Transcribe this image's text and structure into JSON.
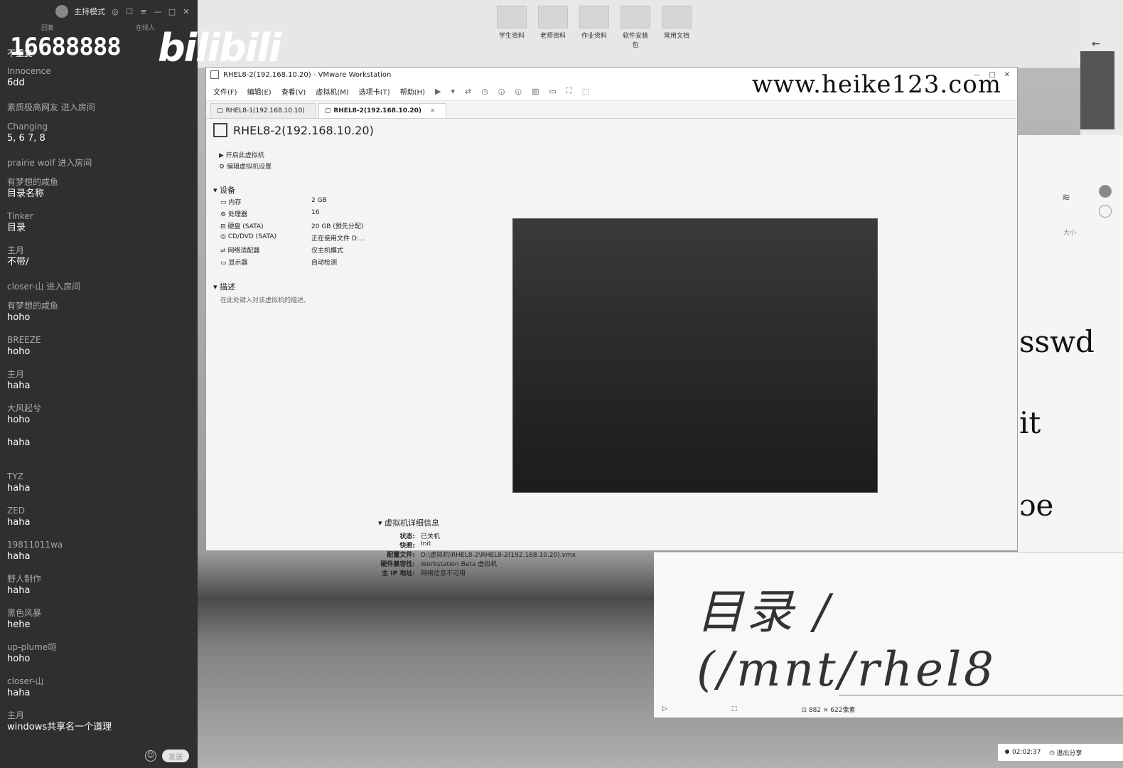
{
  "chat": {
    "host_mode": "主持模式",
    "sub_left": "回复",
    "sub_right": "在线人",
    "big_number": "16688888",
    "brand": "bilibili",
    "banner_label": "不重复",
    "messages": [
      {
        "user": "Innocence",
        "text": "6dd"
      },
      {
        "user": "素质极高网友 进入房间",
        "text": ""
      },
      {
        "user": "Changing",
        "text": "5, 6 7, 8"
      },
      {
        "user": "prairie wolf 进入房间",
        "text": ""
      },
      {
        "user": "有梦想的咸鱼",
        "text": "目录名称"
      },
      {
        "user": "Tinker",
        "text": "目录"
      },
      {
        "user": "主月",
        "text": "不带/"
      },
      {
        "user": "closer-山     进入房间",
        "text": ""
      },
      {
        "user": "有梦想的咸鱼",
        "text": "hoho"
      },
      {
        "user": "BREEZE",
        "text": "hoho"
      },
      {
        "user": "主月",
        "text": "haha"
      },
      {
        "user": "大风起兮",
        "text": "hoho"
      },
      {
        "user": "",
        "text": "haha"
      },
      {
        "user": "TYZ",
        "text": "haha"
      },
      {
        "user": "ZED",
        "text": "haha"
      },
      {
        "user": "19811011wa",
        "text": "haha"
      },
      {
        "user": "野人制作",
        "text": "haha"
      },
      {
        "user": "黑色风暴",
        "text": "hehe"
      },
      {
        "user": "up-plume翊",
        "text": "hoho"
      },
      {
        "user": "closer-山",
        "text": "haha"
      },
      {
        "user": "主月",
        "text": "windows共享名一个道理"
      }
    ],
    "send_label": "发送"
  },
  "desktop": {
    "icons": [
      "学生资料",
      "老师资料",
      "作业资料",
      "软件安装包",
      "常用文档"
    ]
  },
  "vmware": {
    "window_title": "RHEL8-2(192.168.10.20) - VMware Workstation",
    "watermark": "www.heike123.com",
    "menu": [
      "文件(F)",
      "编辑(E)",
      "查看(V)",
      "虚拟机(M)",
      "选项卡(T)",
      "帮助(H)"
    ],
    "tabs": [
      {
        "label": "RHEL8-1(192.168.10.10)"
      },
      {
        "label": "RHEL8-2(192.168.10.20)"
      }
    ],
    "vm_name": "RHEL8-2(192.168.10.20)",
    "actions": [
      "开启此虚拟机",
      "编辑虚拟机设置"
    ],
    "devices_header": "设备",
    "devices": [
      {
        "name": "内存",
        "value": "2 GB"
      },
      {
        "name": "处理器",
        "value": "16"
      },
      {
        "name": "硬盘 (SATA)",
        "value": "20 GB (预先分配)"
      },
      {
        "name": "CD/DVD (SATA)",
        "value": "正在使用文件 D:..."
      },
      {
        "name": "网络适配器",
        "value": "仅主机模式"
      },
      {
        "name": "显示器",
        "value": "自动检测"
      }
    ],
    "description_header": "描述",
    "description_hint": "在此处键入对该虚拟机的描述。",
    "details_header": "虚拟机详细信息",
    "details": [
      {
        "key": "状态:",
        "value": "已关机"
      },
      {
        "key": "快照:",
        "value": "Init"
      },
      {
        "key": "配置文件:",
        "value": "D:\\虚拟机\\RHEL8-2\\RHEL8-2(192.168.10.20).vmx"
      },
      {
        "key": "硬件兼容性:",
        "value": "Workstation Beta 虚拟机"
      },
      {
        "key": "主 IP 地址:",
        "value": "网络信息不可用"
      }
    ]
  },
  "right_panel": {
    "lines": [
      "sswd",
      "it",
      "ɔe"
    ],
    "size_label": "大小"
  },
  "handwriting": {
    "text": "目录 / (/mnt/rhel8",
    "status_size": "882 × 622像素"
  },
  "taskbar": {
    "time": "02:02:37",
    "exit_share": "退出分享"
  }
}
